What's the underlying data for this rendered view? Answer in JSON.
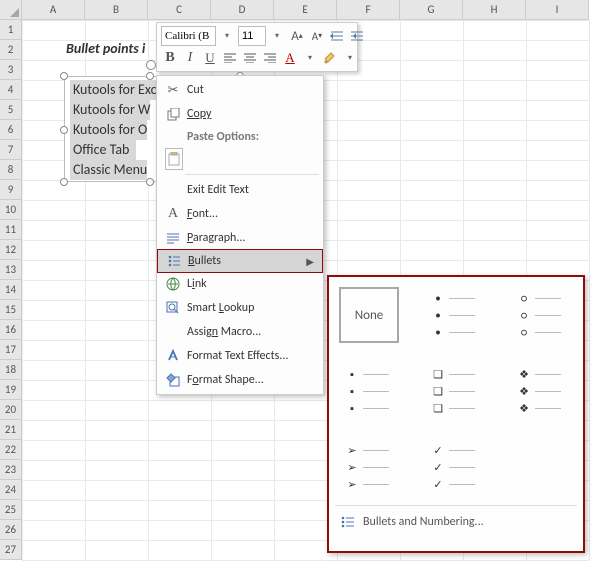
{
  "columns": [
    "A",
    "B",
    "C",
    "D",
    "E",
    "F",
    "G",
    "H",
    "I"
  ],
  "rows": [
    "1",
    "2",
    "3",
    "4",
    "5",
    "6",
    "7",
    "8",
    "9",
    "10",
    "11",
    "12",
    "13",
    "14",
    "15",
    "16",
    "17",
    "18",
    "19",
    "20",
    "21",
    "22",
    "23",
    "24",
    "25",
    "26",
    "27"
  ],
  "title_visible": "Bullet points i",
  "textbox_lines": [
    "Kutools for Excel",
    "Kutools for W",
    "Kutools for O",
    "Office Tab",
    "Classic Menu"
  ],
  "mini": {
    "font": "Calibri (B",
    "size": "11",
    "grow": "A",
    "shrink": "A",
    "bold": "B",
    "italic": "I",
    "underline": "U",
    "fontcolor": "A"
  },
  "ctx": {
    "cut": "Cut",
    "copy": "Copy",
    "paste_hdr": "Paste Options:",
    "exit": "Exit Edit Text",
    "font": "Font...",
    "paragraph": "Paragraph...",
    "bullets": "Bullets",
    "link": "Link",
    "smart": "Smart Lookup",
    "macro": "Assign Macro...",
    "effects": "Format Text Effects...",
    "shape": "Format Shape..."
  },
  "flyout": {
    "none": "None",
    "footer": "Bullets and Numbering..."
  }
}
